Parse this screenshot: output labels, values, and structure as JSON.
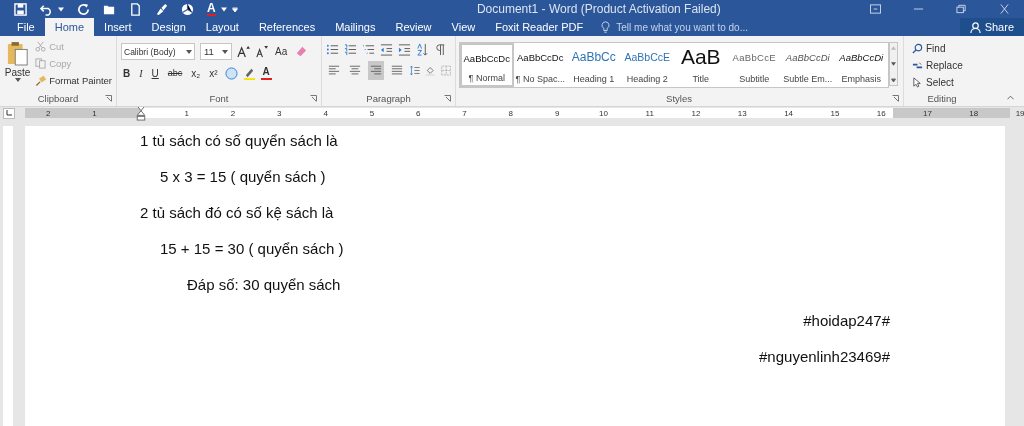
{
  "window": {
    "title": "Document1 - Word (Product Activation Failed)",
    "font_color_label": "A"
  },
  "tabs": [
    {
      "label": "File",
      "selected": false
    },
    {
      "label": "Home",
      "selected": true
    },
    {
      "label": "Insert",
      "selected": false
    },
    {
      "label": "Design",
      "selected": false
    },
    {
      "label": "Layout",
      "selected": false
    },
    {
      "label": "References",
      "selected": false
    },
    {
      "label": "Mailings",
      "selected": false
    },
    {
      "label": "Review",
      "selected": false
    },
    {
      "label": "View",
      "selected": false
    },
    {
      "label": "Foxit Reader PDF",
      "selected": false
    }
  ],
  "tell_me": {
    "placeholder": "Tell me what you want to do..."
  },
  "share": "Share",
  "clipboard": {
    "paste": "Paste",
    "items": [
      {
        "label": "Cut",
        "disabled": true
      },
      {
        "label": "Copy",
        "disabled": true
      },
      {
        "label": "Format Painter",
        "disabled": false
      }
    ],
    "group": "Clipboard"
  },
  "font": {
    "name": "Calibri (Body)",
    "size": "11",
    "case": "Aa",
    "buttons": [
      "B",
      "I",
      "U",
      "abc",
      "x₂",
      "x²"
    ],
    "color_label": "A",
    "group": "Font"
  },
  "paragraph": {
    "align": [
      {
        "selected": false
      },
      {
        "selected": false
      },
      {
        "selected": true
      },
      {
        "selected": false
      }
    ],
    "group": "Paragraph"
  },
  "styles": {
    "items": [
      {
        "kind": "normal",
        "preview": "AaBbCcDc",
        "name": "¶ Normal",
        "selected": true
      },
      {
        "kind": "nospacing",
        "preview": "AaBbCcDc",
        "name": "¶ No Spac...",
        "selected": false
      },
      {
        "kind": "heading1",
        "preview": "AaBbCc",
        "name": "Heading 1",
        "selected": false
      },
      {
        "kind": "heading2",
        "preview": "AaBbCcE",
        "name": "Heading 2",
        "selected": false
      },
      {
        "kind": "title",
        "preview": "AaB",
        "name": "Title",
        "selected": false
      },
      {
        "kind": "subtitle",
        "preview": "AaBbCcE",
        "name": "Subtitle",
        "selected": false
      },
      {
        "kind": "subtle",
        "preview": "AaBbCcDi",
        "name": "Subtle Em...",
        "selected": false
      },
      {
        "kind": "emphasis",
        "preview": "AaBbCcDi",
        "name": "Emphasis",
        "selected": false
      }
    ],
    "group": "Styles"
  },
  "editing": {
    "items": [
      "Find",
      "Replace",
      "Select"
    ],
    "group": "Editing"
  },
  "ruler": [
    "2",
    "1",
    "1",
    "2",
    "3",
    "4",
    "5",
    "6",
    "7",
    "8",
    "9",
    "10",
    "11",
    "12",
    "13",
    "14",
    "15",
    "16",
    "17",
    "18",
    "19"
  ],
  "document": [
    {
      "kind": "statement",
      "text": "1 tủ sách có số quyển sách là"
    },
    {
      "kind": "calc",
      "text": "5 x 3 = 15 ( quyển sách )"
    },
    {
      "kind": "statement",
      "text": "2 tủ sách đó có số kệ sách là"
    },
    {
      "kind": "calc",
      "text": "15 + 15 = 30 ( quyển sách )"
    },
    {
      "kind": "answer",
      "text": "Đáp số: 30 quyển sách"
    },
    {
      "kind": "tag",
      "text": "#hoidap247#"
    },
    {
      "kind": "tag",
      "text": "#nguyenlinh23469#"
    }
  ]
}
